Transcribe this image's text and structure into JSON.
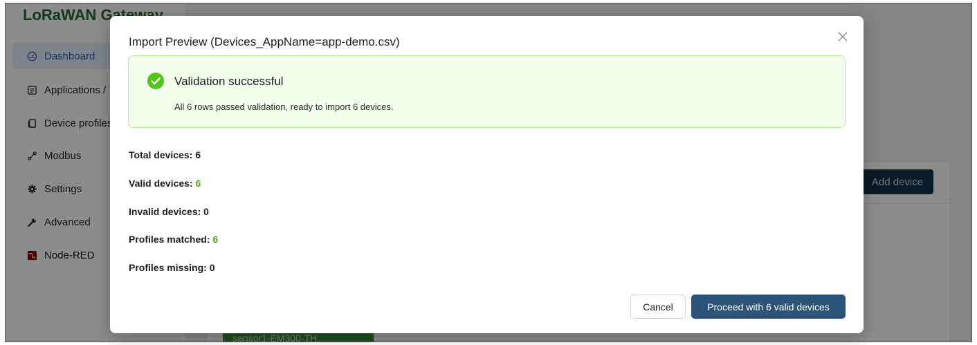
{
  "app": {
    "brand": "LoRaWAN Gateway"
  },
  "sidebar": {
    "items": [
      {
        "label": "Dashboard",
        "icon": "dashboard-icon",
        "active": true
      },
      {
        "label": "Applications /",
        "icon": "applications-icon",
        "active": false
      },
      {
        "label": "Device profiles",
        "icon": "device-profiles-icon",
        "active": false
      },
      {
        "label": "Modbus",
        "icon": "modbus-icon",
        "active": false
      },
      {
        "label": "Settings",
        "icon": "gear-icon",
        "active": false
      },
      {
        "label": "Advanced",
        "icon": "wrench-icon",
        "active": false
      },
      {
        "label": "Node-RED",
        "icon": "node-red-icon",
        "active": false
      }
    ]
  },
  "background": {
    "add_device_label": "Add device",
    "row_chip_label": "sensor1-EM300-TH"
  },
  "modal": {
    "title": "Import Preview (Devices_AppName=app-demo.csv)",
    "close_icon": "close-icon",
    "alert": {
      "icon": "check-circle-icon",
      "title": "Validation successful",
      "description": "All 6 rows passed validation, ready to import 6 devices."
    },
    "stats": [
      {
        "label": "Total devices:",
        "value": "6",
        "highlight": false
      },
      {
        "label": "Valid devices:",
        "value": "6",
        "highlight": true
      },
      {
        "label": "Invalid devices:",
        "value": "0",
        "highlight": false
      },
      {
        "label": "Profiles matched:",
        "value": "6",
        "highlight": true
      },
      {
        "label": "Profiles missing:",
        "value": "0",
        "highlight": false
      }
    ],
    "cancel_label": "Cancel",
    "proceed_label": "Proceed with 6 valid devices"
  },
  "colors": {
    "primary": "#2c5378",
    "success": "#52c41a",
    "success_bg": "#f5ffed",
    "brand_green": "#1f6b2e"
  }
}
